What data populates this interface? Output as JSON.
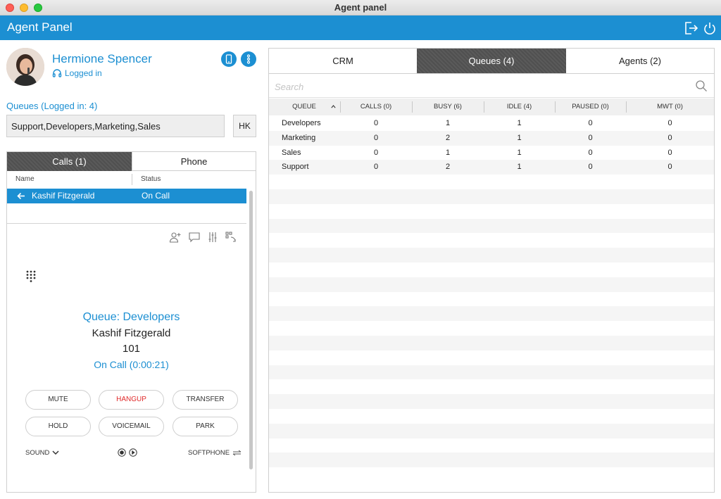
{
  "window": {
    "title": "Agent panel"
  },
  "header": {
    "title": "Agent Panel",
    "logout_icon": "exit-icon",
    "power_icon": "power-icon"
  },
  "agent": {
    "name": "Hermione Spencer",
    "status": "Logged in",
    "queues_label": "Queues (Logged in: 4)",
    "queues_value": "Support,Developers,Marketing,Sales",
    "hk_label": "HK"
  },
  "left_tabs": [
    {
      "label": "Calls (1)",
      "active": true
    },
    {
      "label": "Phone",
      "active": false
    }
  ],
  "calls_table": {
    "columns": [
      "Name",
      "Status"
    ],
    "rows": [
      {
        "name": "Kashif Fitzgerald",
        "status": "On Call",
        "direction": "incoming"
      }
    ]
  },
  "call_detail": {
    "queue": "Queue: Developers",
    "caller": "Kashif Fitzgerald",
    "extension": "101",
    "state": "On Call (0:00:21)"
  },
  "call_buttons": {
    "mute": "MUTE",
    "hangup": "HANGUP",
    "transfer": "TRANSFER",
    "hold": "HOLD",
    "voicemail": "VOICEMAIL",
    "park": "PARK"
  },
  "bottom_bar": {
    "sound": "SOUND",
    "softphone": "SOFTPHONE"
  },
  "right_tabs": [
    {
      "label": "CRM",
      "active": false
    },
    {
      "label": "Queues (4)",
      "active": true
    },
    {
      "label": "Agents (2)",
      "active": false
    }
  ],
  "search": {
    "placeholder": "Search"
  },
  "queues_table": {
    "columns": [
      "QUEUE",
      "CALLS (0)",
      "BUSY (6)",
      "IDLE (4)",
      "PAUSED (0)",
      "MWT (0)"
    ],
    "rows": [
      [
        "Developers",
        "0",
        "1",
        "1",
        "0",
        "0"
      ],
      [
        "Marketing",
        "0",
        "2",
        "1",
        "0",
        "0"
      ],
      [
        "Sales",
        "0",
        "1",
        "1",
        "0",
        "0"
      ],
      [
        "Support",
        "0",
        "2",
        "1",
        "0",
        "0"
      ]
    ]
  },
  "colors": {
    "accent": "#1c8fd2",
    "hangup": "#e02a2a",
    "active_tab": "#555555"
  }
}
